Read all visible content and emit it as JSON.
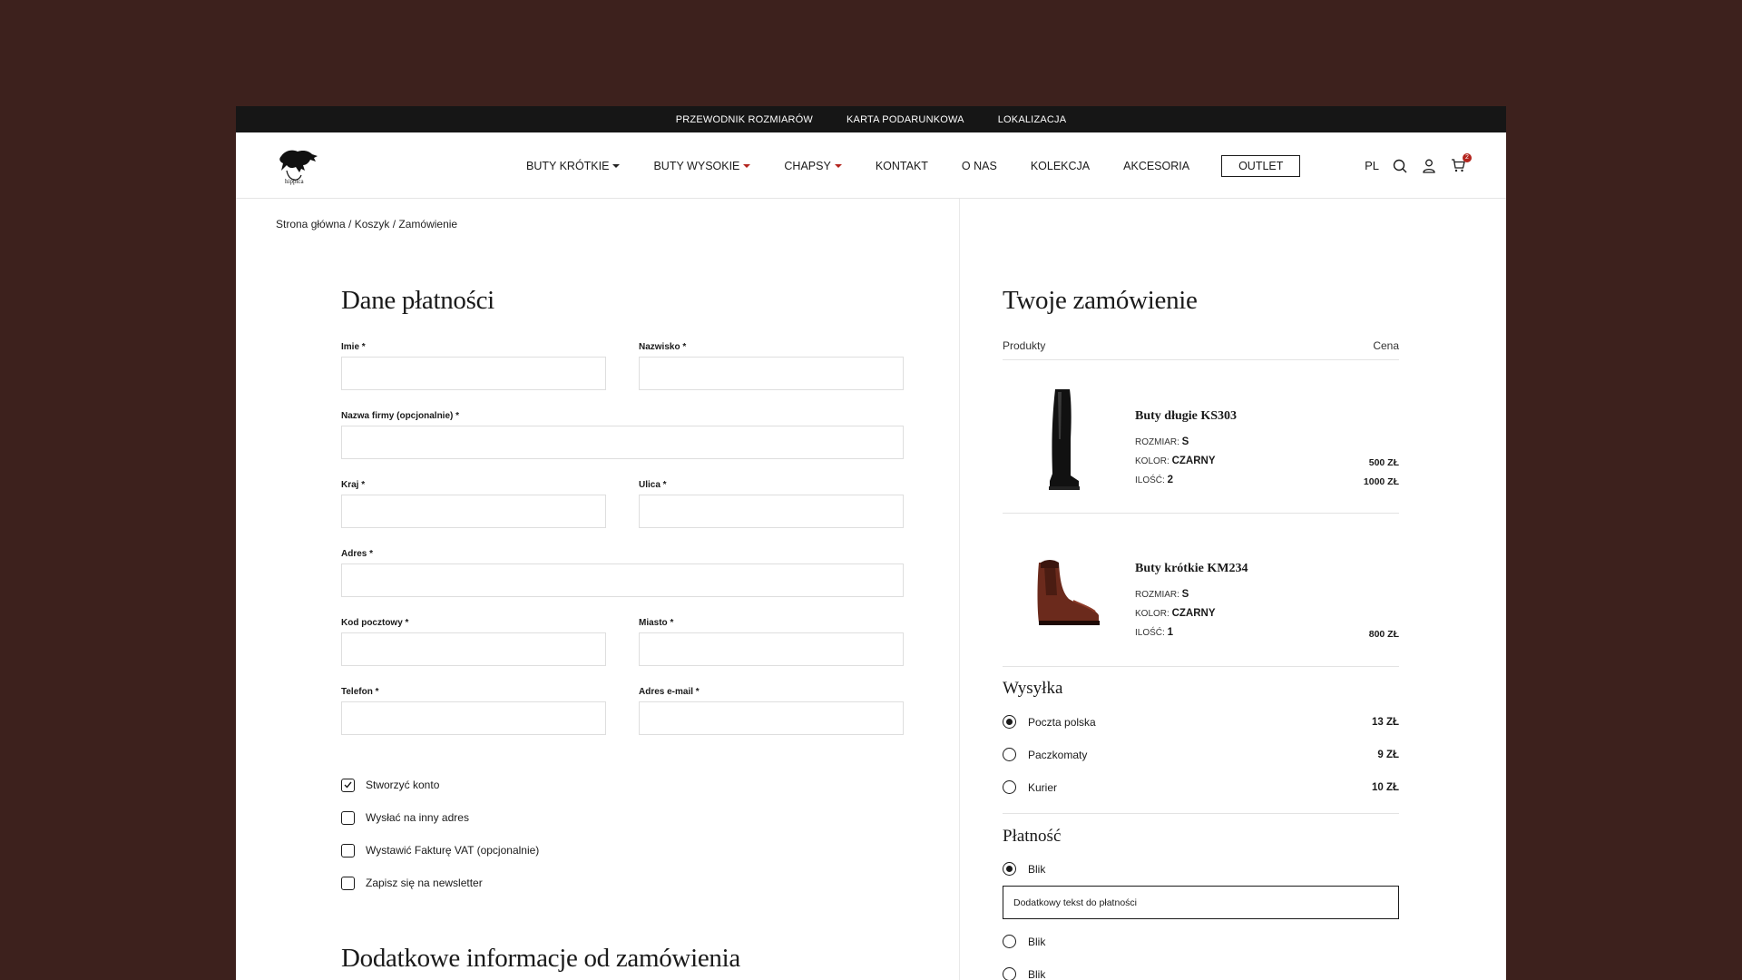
{
  "topbar": {
    "links": [
      "PRZEWODNIK ROZMIARÓW",
      "KARTA PODARUNKOWA",
      "LOKALIZACJA"
    ]
  },
  "nav": {
    "items": [
      "BUTY KRÓTKIE",
      "BUTY WYSOKIE",
      "CHAPSY",
      "KONTAKT",
      "O NAS",
      "KOLEKCJA",
      "AKCESORIA"
    ],
    "outlet": "OUTLET",
    "lang": "PL",
    "cart_count": "2"
  },
  "breadcrumb": "Strona główna / Koszyk / Zamówienie",
  "billing": {
    "title": "Dane płatności",
    "fields": {
      "imie": "Imie *",
      "nazwisko": "Nazwisko *",
      "firma": "Nazwa firmy (opcjonalnie) *",
      "kraj": "Kraj *",
      "ulica": "Ulica *",
      "adres": "Adres *",
      "kod": "Kod pocztowy *",
      "miasto": "Miasto *",
      "telefon": "Telefon *",
      "email": "Adres e-mail *"
    },
    "checkboxes": [
      {
        "label": "Stworzyć konto",
        "checked": true
      },
      {
        "label": "Wysłać na inny adres",
        "checked": false
      },
      {
        "label": "Wystawić Fakturę VAT (opcjonalnie)",
        "checked": false
      },
      {
        "label": "Zapisz się na newsletter",
        "checked": false
      }
    ],
    "extra_title": "Dodatkowe informacje od zamówienia"
  },
  "order": {
    "title": "Twoje zamówienie",
    "col_products": "Produkty",
    "col_price": "Cena",
    "products": [
      {
        "name": "Buty długie KS303",
        "size_label": "ROZMIAR:",
        "size": "S",
        "color_label": "KOLOR:",
        "color": "CZARNY",
        "qty_label": "ILOŚĆ:",
        "qty": "2",
        "unit_price": "500 ZŁ",
        "total": "1000 ZŁ"
      },
      {
        "name": "Buty krótkie KM234",
        "size_label": "ROZMIAR:",
        "size": "S",
        "color_label": "KOLOR:",
        "color": "CZARNY",
        "qty_label": "ILOŚĆ:",
        "qty": "1",
        "total": "800 ZŁ"
      }
    ],
    "shipping_title": "Wysyłka",
    "shipping": [
      {
        "label": "Poczta polska",
        "price": "13 ZŁ",
        "selected": true
      },
      {
        "label": "Paczkomaty",
        "price": "9 ZŁ",
        "selected": false
      },
      {
        "label": "Kurier",
        "price": "10 ZŁ",
        "selected": false
      }
    ],
    "payment_title": "Płatność",
    "payments": [
      {
        "label": "Blik",
        "selected": true
      },
      {
        "label": "Blik",
        "selected": false
      },
      {
        "label": "Blik",
        "selected": false
      }
    ],
    "payment_note": "Dodatkowy tekst do płatności"
  }
}
